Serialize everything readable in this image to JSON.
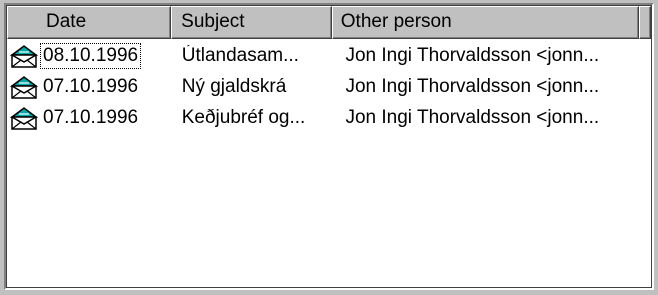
{
  "columns": {
    "date": "Date",
    "subject": "Subject",
    "other": "Other person"
  },
  "messages": [
    {
      "date": "08.10.1996",
      "subject": "Útlandasam...",
      "other": "Jon Ingi Thorvaldsson <jonn...",
      "icon": "envelope-icon",
      "focused": true
    },
    {
      "date": "07.10.1996",
      "subject": "Ný gjaldskrá",
      "other": "Jon Ingi Thorvaldsson <jonn...",
      "icon": "envelope-icon",
      "focused": false
    },
    {
      "date": "07.10.1996",
      "subject": "Keðjubréf og...",
      "other": "Jon Ingi Thorvaldsson <jonn...",
      "icon": "envelope-icon",
      "focused": false
    }
  ],
  "colors": {
    "window_bg": "#c0c0c0",
    "list_bg": "#ffffff",
    "icon_teal": "#00a8a8"
  }
}
